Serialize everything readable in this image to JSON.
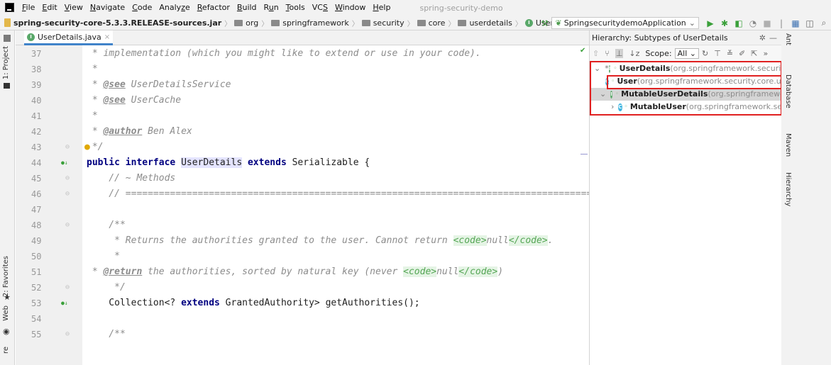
{
  "window": {
    "title": "spring-security-demo",
    "controls": [
      "—",
      "◻",
      "✕"
    ]
  },
  "menu": [
    {
      "label": "File",
      "u": "F",
      "rest": "ile"
    },
    {
      "label": "Edit",
      "u": "E",
      "rest": "dit"
    },
    {
      "label": "View",
      "u": "V",
      "rest": "iew"
    },
    {
      "label": "Navigate",
      "u": "N",
      "rest": "avigate"
    },
    {
      "label": "Code",
      "u": "C",
      "rest": "ode"
    },
    {
      "label": "Analyze",
      "pre": "Analy",
      "u": "z",
      "rest": "e"
    },
    {
      "label": "Refactor",
      "u": "R",
      "rest": "efactor"
    },
    {
      "label": "Build",
      "u": "B",
      "rest": "uild"
    },
    {
      "label": "Run",
      "pre": "R",
      "u": "u",
      "rest": "n"
    },
    {
      "label": "Tools",
      "u": "T",
      "rest": "ools"
    },
    {
      "label": "VCS",
      "pre": "VC",
      "u": "S",
      "rest": ""
    },
    {
      "label": "Window",
      "u": "W",
      "rest": "indow"
    },
    {
      "label": "Help",
      "u": "H",
      "rest": "elp"
    }
  ],
  "breadcrumbs": {
    "jar": "spring-security-core-5.3.3.RELEASE-sources.jar",
    "folders": [
      "org",
      "springframework",
      "security",
      "core",
      "userdetails"
    ],
    "current": "UserDetails",
    "current_badge": "I"
  },
  "run_config": "SpringsecuritydemoApplication",
  "left_tabs": [
    "1: Project",
    "2: Favorites",
    "Web",
    "re"
  ],
  "editor": {
    "tab_label": "UserDetails.java",
    "lines": [
      {
        "n": "37",
        "text": " * implementation (which you might like to extend or use in your code)."
      },
      {
        "n": "38",
        "text": " *"
      },
      {
        "n": "39",
        "tag": "@see",
        "text": " UserDetailsService"
      },
      {
        "n": "40",
        "tag": "@see",
        "text": " UserCache"
      },
      {
        "n": "41",
        "text": " *"
      },
      {
        "n": "42",
        "tag": "@author",
        "text": " Ben Alex"
      },
      {
        "n": "43",
        "text": " */"
      },
      {
        "n": "44",
        "kw1": "public interface ",
        "name": "UserDetails",
        "kw2": " extends ",
        "tail": "Serializable {"
      },
      {
        "n": "45",
        "text": "    // ~ Methods"
      },
      {
        "n": "46",
        "text": "    // ========================================================================================================"
      },
      {
        "n": "47",
        "text": ""
      },
      {
        "n": "48",
        "text": "    /**"
      },
      {
        "n": "49",
        "text": "     * Returns the authorities granted to the user. Cannot return ",
        "code1": "<code>",
        "mid": "null",
        "code2": "</code>",
        "end": "."
      },
      {
        "n": "50",
        "text": "     *"
      },
      {
        "n": "51",
        "tag": "@return",
        "text": " the authorities, sorted by natural key (never ",
        "code1": "<code>",
        "mid": "null",
        "code2": "</code>",
        "end": ")"
      },
      {
        "n": "52",
        "text": "     */"
      },
      {
        "n": "53",
        "pre": "    Collection<? ",
        "kw": "extends",
        "tail": " GrantedAuthority> getAuthorities();"
      },
      {
        "n": "54",
        "text": ""
      },
      {
        "n": "55",
        "text": "    /**"
      }
    ]
  },
  "hierarchy": {
    "title": "Hierarchy: Subtypes of UserDetails",
    "scope_label": "Scope:",
    "scope_value": "All",
    "tree": [
      {
        "name": "UserDetails",
        "pkg": " (org.springframework.security.core.",
        "badge": "I"
      },
      {
        "name": "User",
        "pkg": " (org.springframework.security.core.user",
        "badge": "C"
      },
      {
        "name": "MutableUserDetails",
        "pkg": " (org.springframework.security",
        "badge": "I"
      },
      {
        "name": "MutableUser",
        "pkg": " (org.springframework.security",
        "badge": "C"
      }
    ]
  },
  "right_tabs": [
    "Ant",
    "Database",
    "Maven",
    "Hierarchy"
  ],
  "colors": {
    "accent": "#4083c9",
    "highlight_border": "#e02020",
    "keyword": "#000080"
  }
}
